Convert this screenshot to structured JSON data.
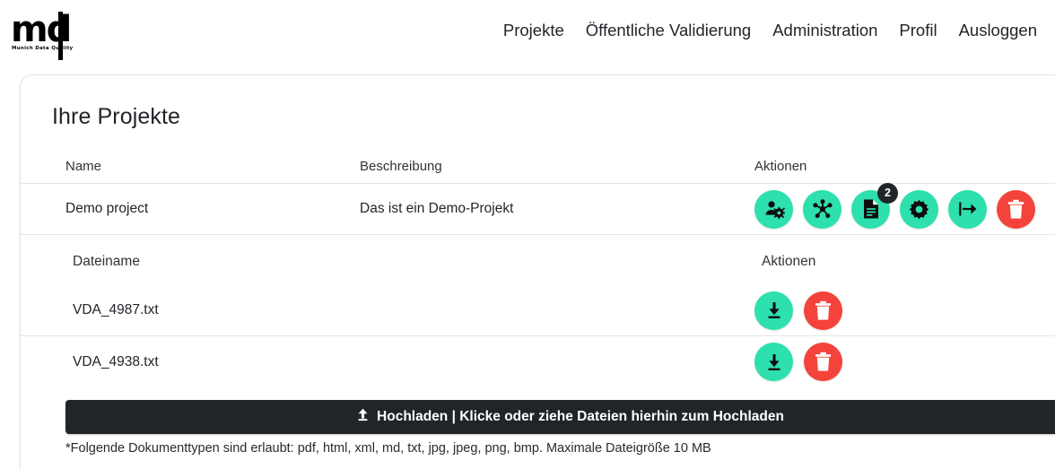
{
  "navbar": {
    "logo": {
      "mark": "md",
      "subtitle": "Munich Data Quality",
      "icon": "md-logo-icon"
    },
    "links": [
      {
        "label": "Projekte",
        "name": "nav-link-projekte"
      },
      {
        "label": "Öffentliche Validierung",
        "name": "nav-link-oeffentliche-validierung"
      },
      {
        "label": "Administration",
        "name": "nav-link-administration"
      },
      {
        "label": "Profil",
        "name": "nav-link-profil"
      },
      {
        "label": "Ausloggen",
        "name": "nav-link-ausloggen"
      }
    ]
  },
  "card": {
    "title": "Ihre Projekte",
    "projects_table": {
      "headers": {
        "name": "Name",
        "description": "Beschreibung",
        "actions": "Aktionen"
      },
      "rows": [
        {
          "name": "Demo project",
          "description": "Das ist ein Demo-Projekt",
          "actions": [
            {
              "icon": "user-settings-icon",
              "label": "Benutzer verwalten",
              "color": "#2de0ad",
              "badge": null
            },
            {
              "icon": "network-nodes-icon",
              "label": "Netzwerk",
              "color": "#2de0ad",
              "badge": null
            },
            {
              "icon": "document-icon",
              "label": "Dokumente",
              "color": "#2de0ad",
              "badge": "2"
            },
            {
              "icon": "gear-icon",
              "label": "Einstellungen",
              "color": "#2de0ad",
              "badge": null
            },
            {
              "icon": "export-arrow-icon",
              "label": "Exportieren",
              "color": "#2de0ad",
              "badge": null
            },
            {
              "icon": "trash-icon",
              "label": "Löschen",
              "color": "#f4433a",
              "badge": null
            }
          ]
        }
      ]
    },
    "files_table": {
      "headers": {
        "filename": "Dateiname",
        "actions": "Aktionen"
      },
      "rows": [
        {
          "filename": "VDA_4987.txt",
          "actions": [
            {
              "icon": "download-icon",
              "label": "Herunterladen",
              "color": "#2de0ad"
            },
            {
              "icon": "trash-icon",
              "label": "Löschen",
              "color": "#f4433a"
            }
          ]
        },
        {
          "filename": "VDA_4938.txt",
          "actions": [
            {
              "icon": "download-icon",
              "label": "Herunterladen",
              "color": "#2de0ad"
            },
            {
              "icon": "trash-icon",
              "label": "Löschen",
              "color": "#f4433a"
            }
          ]
        }
      ]
    },
    "upload": {
      "icon": "upload-arrow-icon",
      "label": "Hochladen | Klicke oder ziehe Dateien hierhin zum Hochladen"
    },
    "note": "*Folgende Dokumenttypen sind erlaubt: pdf, html, xml, md, txt, jpg, jpeg, png, bmp. Maximale Dateigröße 10 MB"
  },
  "colors": {
    "accent_teal": "#2de0ad",
    "danger_red": "#f4433a",
    "dark": "#212529",
    "page_bg": "#ffffff"
  }
}
